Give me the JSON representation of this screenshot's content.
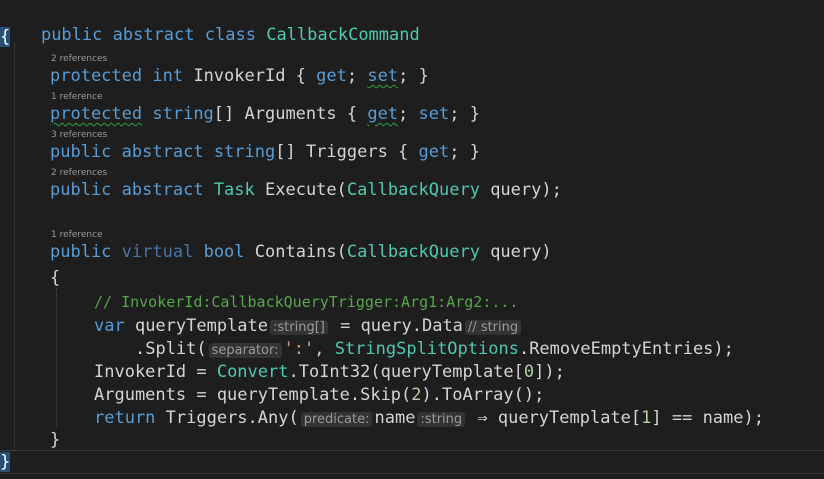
{
  "lenses": {
    "invoker_id": "2 references",
    "arguments": "1 reference",
    "triggers": "3 references",
    "execute": "2 references",
    "contains": "1 reference"
  },
  "line_class": {
    "kw1": "public",
    "kw2": "abstract",
    "kw3": "class",
    "name": "CallbackCommand"
  },
  "brace_open": "{",
  "brace_close": "}",
  "line_invoker": {
    "kw1": "protected",
    "kw2": "int",
    "rest": " InvokerId { ",
    "get": "get",
    "semi": ";",
    "set": "set",
    "end": "; }"
  },
  "line_arguments": {
    "kw1": "protected",
    "kw2": "string",
    "mid": "[] Arguments { ",
    "get": "get",
    "semi": "; ",
    "set": "set",
    "end": "; }"
  },
  "line_triggers": {
    "kw1": "public",
    "kw2": "abstract",
    "kw3": "string",
    "mid": "[] Triggers { ",
    "get": "get",
    "end": "; }"
  },
  "line_execute": {
    "kw1": "public",
    "kw2": "abstract",
    "type": "Task",
    "mid": " Execute(",
    "param_type": "CallbackQuery",
    "end": " query);"
  },
  "line_contains": {
    "kw1": "public",
    "kw2": "virtual",
    "kw3": "bool",
    "mid": " Contains(",
    "param_type": "CallbackQuery",
    "end": " query)"
  },
  "method_open": "{",
  "method_close": "}",
  "comment": "// InvokerId:CallbackQueryTrigger:Arg1:Arg2:...",
  "line_var": {
    "kw": "var",
    "name": " queryTemplate",
    "hint": ":string[]",
    "mid": " = query.Data",
    "hint2": "// string"
  },
  "line_split": {
    "pre": ".Split(",
    "hint": "separator:",
    "str": "':'",
    "mid": ", ",
    "type": "StringSplitOptions",
    "end": ".RemoveEmptyEntries);"
  },
  "line_convert": {
    "pre": "InvokerId = ",
    "type": "Convert",
    "mid": ".ToInt32(queryTemplate[",
    "num": "0",
    "end": "]);"
  },
  "line_args": {
    "pre": "Arguments = queryTemplate.Skip(",
    "num": "2",
    "end": ").ToArray();"
  },
  "line_return": {
    "kw": "return",
    "pre": " Triggers.Any(",
    "hint": "predicate:",
    "name": "name",
    "hint2": ":string",
    "arrow": " ⇒ queryTemplate[",
    "num": "1",
    "end": "] == name);"
  }
}
